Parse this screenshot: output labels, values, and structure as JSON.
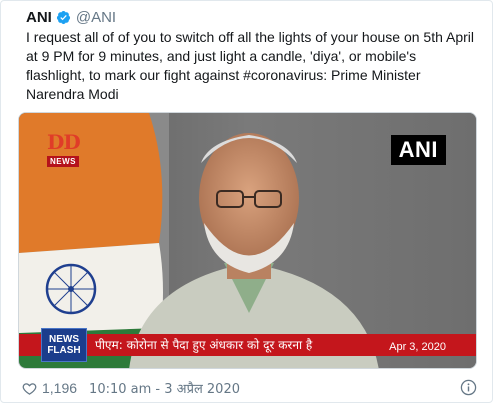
{
  "tweet": {
    "author_name": "ANI",
    "handle": "@ANI",
    "text": "I request all of of you to switch off all the lights of your house on 5th April at 9 PM for 9 minutes, and just light a candle, 'diya',  or mobile's flashlight, to mark our fight against #coronavirus: Prime Minister Narendra Modi",
    "verified_icon": "verified-badge-icon"
  },
  "media": {
    "channel_logo_main": "DD",
    "channel_logo_sub": "NEWS",
    "watermark": "ANI",
    "news_flash_label": "NEWS FLASH",
    "ticker_text": "पीएम: कोरोना से पैदा हुए अंधकार को दूर करना है",
    "ticker_date": "Apr 3, 2020"
  },
  "footer": {
    "like_count": "1,196",
    "timestamp": "10:10 am - 3 अप्रैल 2020",
    "heart_icon": "heart-outline-icon",
    "info_icon": "info-icon"
  },
  "colors": {
    "verified": "#1da1f2",
    "text_primary": "#14171a",
    "text_secondary": "#657786",
    "ticker_red": "#c4161c",
    "news_flash_blue": "#1b3d8c"
  }
}
